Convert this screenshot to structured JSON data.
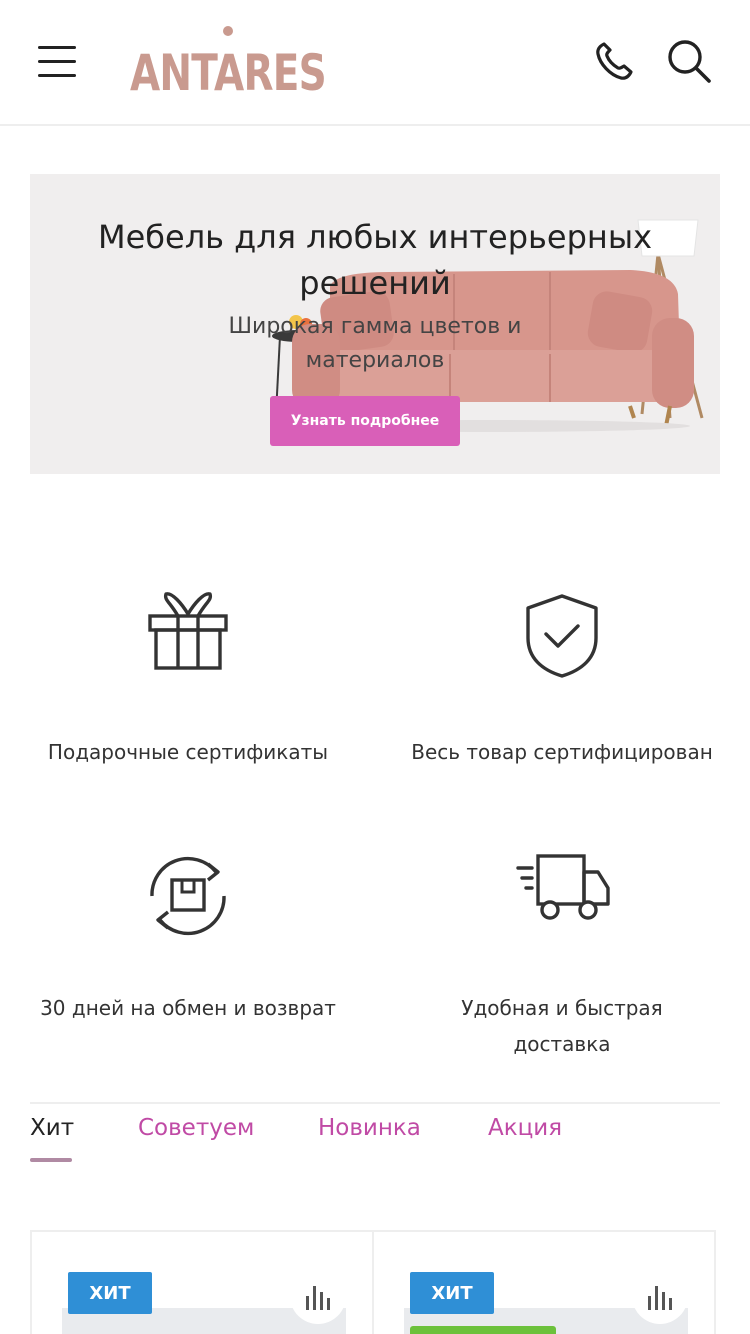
{
  "header": {
    "logo_text": "ANTARES",
    "menu_icon": "hamburger-icon",
    "phone_icon": "phone-icon",
    "search_icon": "search-icon"
  },
  "banner": {
    "title": "Мебель для любых интерьерных решений",
    "subtitle": "Широкая гамма цветов и материалов",
    "button_label": "Узнать подробнее"
  },
  "features": [
    {
      "icon": "gift-icon",
      "label": "Подарочные сертификаты"
    },
    {
      "icon": "shield-check-icon",
      "label": "Весь товар сертифицирован"
    },
    {
      "icon": "return-box-icon",
      "label": "30 дней на обмен и возврат"
    },
    {
      "icon": "delivery-truck-icon",
      "label": "Удобная и быстрая доставка"
    }
  ],
  "tabs": [
    {
      "label": "Хит",
      "active": true
    },
    {
      "label": "Советуем",
      "active": false
    },
    {
      "label": "Новинка",
      "active": false
    },
    {
      "label": "Акция",
      "active": false
    }
  ],
  "products": [
    {
      "badge": "ХИТ",
      "compare_icon": "compare-chart-icon"
    },
    {
      "badge": "ХИТ",
      "compare_icon": "compare-chart-icon"
    }
  ],
  "colors": {
    "accent_pink": "#d95fb8",
    "tab_pink": "#c04aa5",
    "badge_blue": "#2f8fd6",
    "logo": "#c99a8f"
  }
}
